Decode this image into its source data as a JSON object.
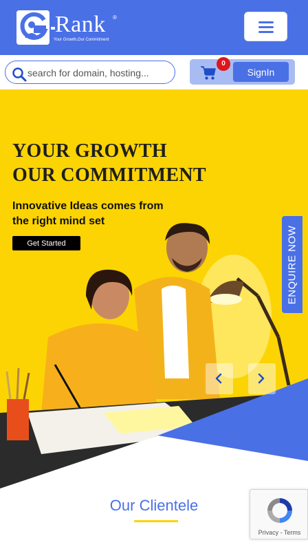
{
  "header": {
    "logo_name": "Rank",
    "logo_registered": "®",
    "logo_tagline": "Your Growth,Our Commitment",
    "menu_icon": "hamburger-icon"
  },
  "search": {
    "placeholder": "search for domain, hosting...",
    "value": ""
  },
  "cart": {
    "count": "0",
    "icon": "cart-icon"
  },
  "signin_label": "SignIn",
  "hero": {
    "title_line1": "YOUR GROWTH",
    "title_line2": "OUR COMMITMENT",
    "subtitle": "Innovative Ideas comes from the right mind set",
    "cta_label": "Get Started",
    "enquire_label": "ENQUIRE NOW"
  },
  "clientele": {
    "title": "Our Clientele"
  },
  "recaptcha": {
    "links": "Privacy - Terms"
  },
  "colors": {
    "brand_blue": "#4a70e6",
    "hero_yellow": "#fcd403",
    "badge_red": "#e0161c"
  }
}
